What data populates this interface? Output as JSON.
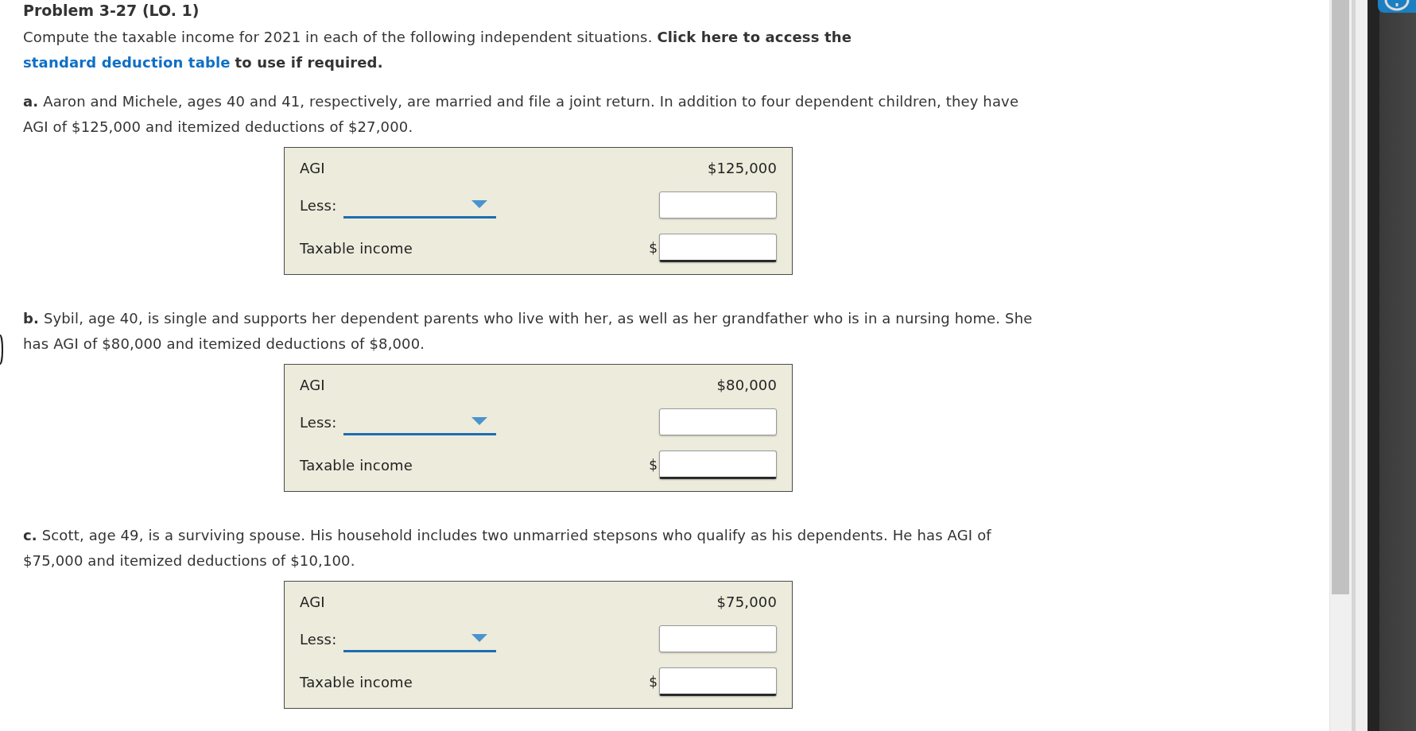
{
  "title": "Problem 3-27 (LO. 1)",
  "intro": {
    "text": "Compute the taxable income for 2021 in each of the following independent situations. **Click here to access the**",
    "link": "standard deduction table",
    "after_link": "to use if required."
  },
  "situations": [
    {
      "text": "**a.** Aaron and Michele, ages 40 and 41, respectively, are married and file a joint return. In addition to four dependent children, they have AGI of $125,000 and itemized deductions of $27,000.",
      "worksheet": {
        "rows": [
          {
            "kind": "amount",
            "label": "AGI",
            "value": "$125,000"
          },
          {
            "kind": "select",
            "label": "Less:"
          },
          {
            "kind": "total",
            "label": "Taxable income",
            "currency": "$"
          }
        ]
      }
    },
    {
      "text": "**b.** Sybil, age 40, is single and supports her dependent parents who live with her, as well as her grandfather who is in a nursing home. She has AGI of $80,000 and itemized deductions of $8,000.",
      "worksheet": {
        "rows": [
          {
            "kind": "amount",
            "label": "AGI",
            "value": "$80,000"
          },
          {
            "kind": "select",
            "label": "Less:"
          },
          {
            "kind": "total",
            "label": "Taxable income",
            "currency": "$"
          }
        ]
      }
    },
    {
      "text": "**c.** Scott, age 49, is a surviving spouse. His household includes two unmarried stepsons who qualify as his dependents. He has AGI of $75,000 and itemized deductions of $10,100.",
      "worksheet": {
        "rows": [
          {
            "kind": "amount",
            "label": "AGI",
            "value": "$75,000"
          },
          {
            "kind": "select",
            "label": "Less:"
          },
          {
            "kind": "total",
            "label": "Taxable income",
            "currency": "$"
          }
        ]
      }
    }
  ]
}
